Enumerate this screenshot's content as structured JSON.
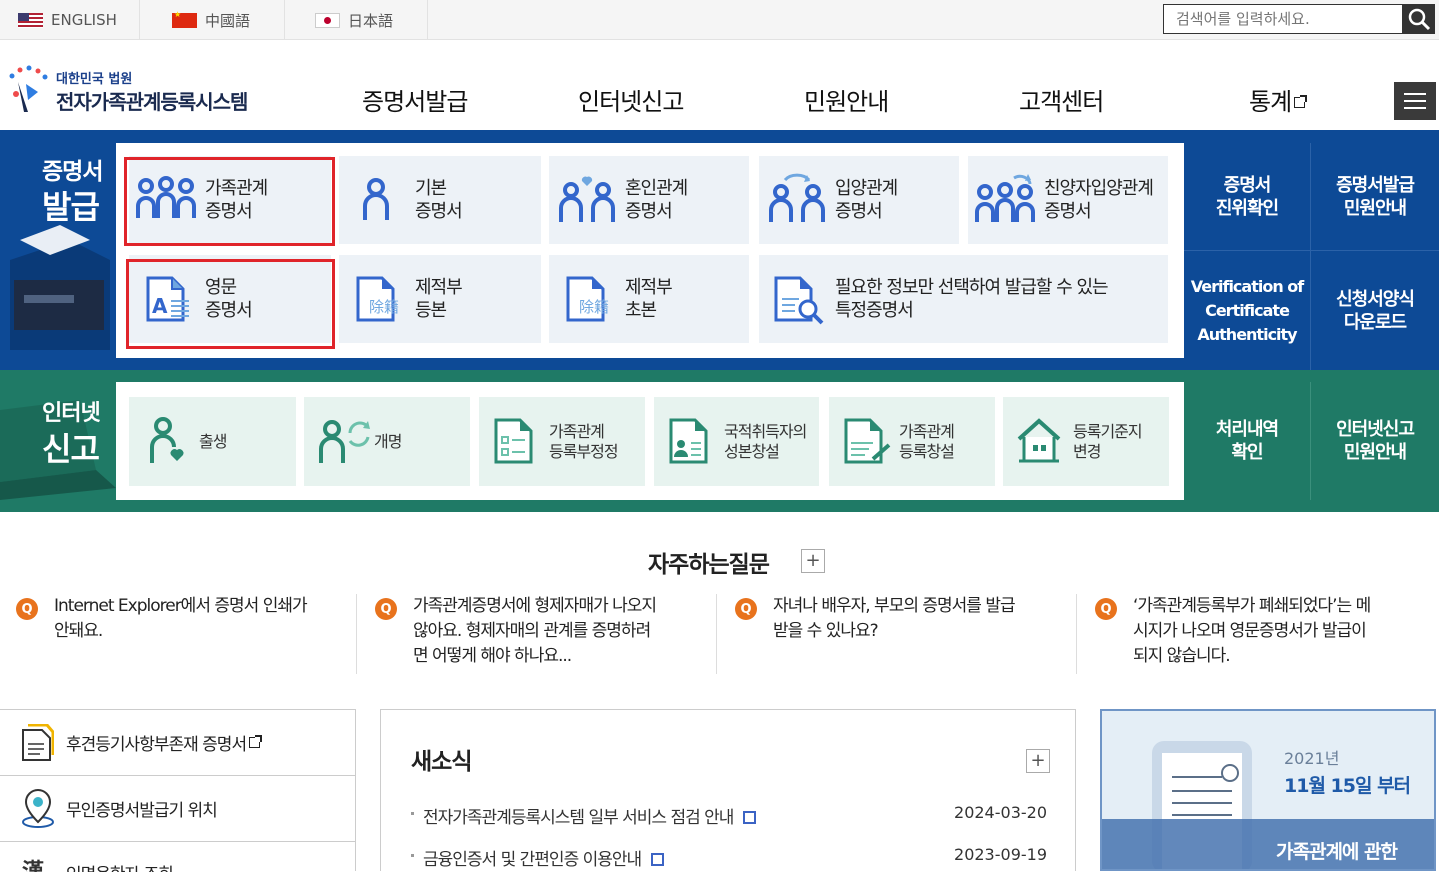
{
  "languages": [
    {
      "label": "ENGLISH",
      "flag": "us-flag-icon"
    },
    {
      "label": "中國語",
      "flag": "cn-flag-icon"
    },
    {
      "label": "日本語",
      "flag": "jp-flag-icon"
    }
  ],
  "search": {
    "placeholder": "검색어를 입력하세요."
  },
  "logo": {
    "sub": "대한민국 법원",
    "main": "전자가족관계등록시스템"
  },
  "gnb": [
    "증명서발급",
    "인터넷신고",
    "민원안내",
    "고객센터",
    "통계"
  ],
  "cert": {
    "title_line1": "증명서",
    "title_line2": "발급",
    "tiles": [
      {
        "label": "가족관계\n증명서",
        "icon": "family-icon"
      },
      {
        "label": "기본\n증명서",
        "icon": "person-icon"
      },
      {
        "label": "혼인관계\n증명서",
        "icon": "couple-heart-icon"
      },
      {
        "label": "입양관계\n증명서",
        "icon": "adoption-icon"
      },
      {
        "label": "친양자입양관계\n증명서",
        "icon": "family-adoption-icon"
      },
      {
        "label": "영문\n증명서",
        "icon": "english-doc-icon"
      },
      {
        "label": "제적부\n등본",
        "icon": "register-doc-icon"
      },
      {
        "label": "제적부\n초본",
        "icon": "register-doc-icon"
      },
      {
        "label": "필요한 정보만 선택하여 발급할 수 있는\n특정증명서",
        "icon": "doc-search-icon"
      }
    ],
    "side": [
      {
        "label": "증명서\n진위확인"
      },
      {
        "label": "증명서발급\n민원안내"
      },
      {
        "label": "Verification of\nCertificate\nAuthenticity"
      },
      {
        "label": "신청서양식\n다운로드"
      }
    ]
  },
  "report": {
    "title_line1": "인터넷",
    "title_line2": "신고",
    "tiles": [
      {
        "label": "출생",
        "icon": "birth-icon"
      },
      {
        "label": "개명",
        "icon": "rename-icon"
      },
      {
        "label": "가족관계\n등록부정정",
        "icon": "correction-doc-icon"
      },
      {
        "label": "국적취득자의\n성본창설",
        "icon": "nationality-doc-icon"
      },
      {
        "label": "가족관계\n등록창설",
        "icon": "create-doc-icon"
      },
      {
        "label": "등록기준지\n변경",
        "icon": "house-icon"
      }
    ],
    "side": [
      {
        "label": "처리내역\n확인"
      },
      {
        "label": "인터넷신고\n민원안내"
      }
    ]
  },
  "faq": {
    "title": "자주하는질문",
    "q_mark": "Q",
    "items": [
      {
        "text": "Internet Explorer에서 증명서 인쇄가\n안돼요."
      },
      {
        "text": "가족관계증명서에 형제자매가 나오지\n않아요. 형제자매의 관계를 증명하려\n면 어떻게 해야 하나요..."
      },
      {
        "text": "자녀나 배우자, 부모의 증명서를 발급\n받을 수 있나요?"
      },
      {
        "text": "‘가족관계등록부가 폐쇄되었다’는 메\n시지가 나오며 영문증명서가 발급이\n되지 않습니다."
      }
    ]
  },
  "quicklinks": [
    {
      "label": "후견등기사항부존재 증명서",
      "icon": "document-icon"
    },
    {
      "label": "무인증명서발급기 위치",
      "icon": "location-pin-icon"
    },
    {
      "label": "인명용한자 조회",
      "icon": "hanja-icon"
    }
  ],
  "news": {
    "title": "새소식",
    "items": [
      {
        "text": "전자가족관계등록시스템 일부 서비스 점검 안내",
        "date": "2024-03-20"
      },
      {
        "text": "금융인증서 및 간편인증 이용안내",
        "date": "2023-09-19"
      }
    ]
  },
  "banner": {
    "year": "2021년",
    "date": "11월 15일 부터",
    "foot": "가족관계에 관한"
  }
}
